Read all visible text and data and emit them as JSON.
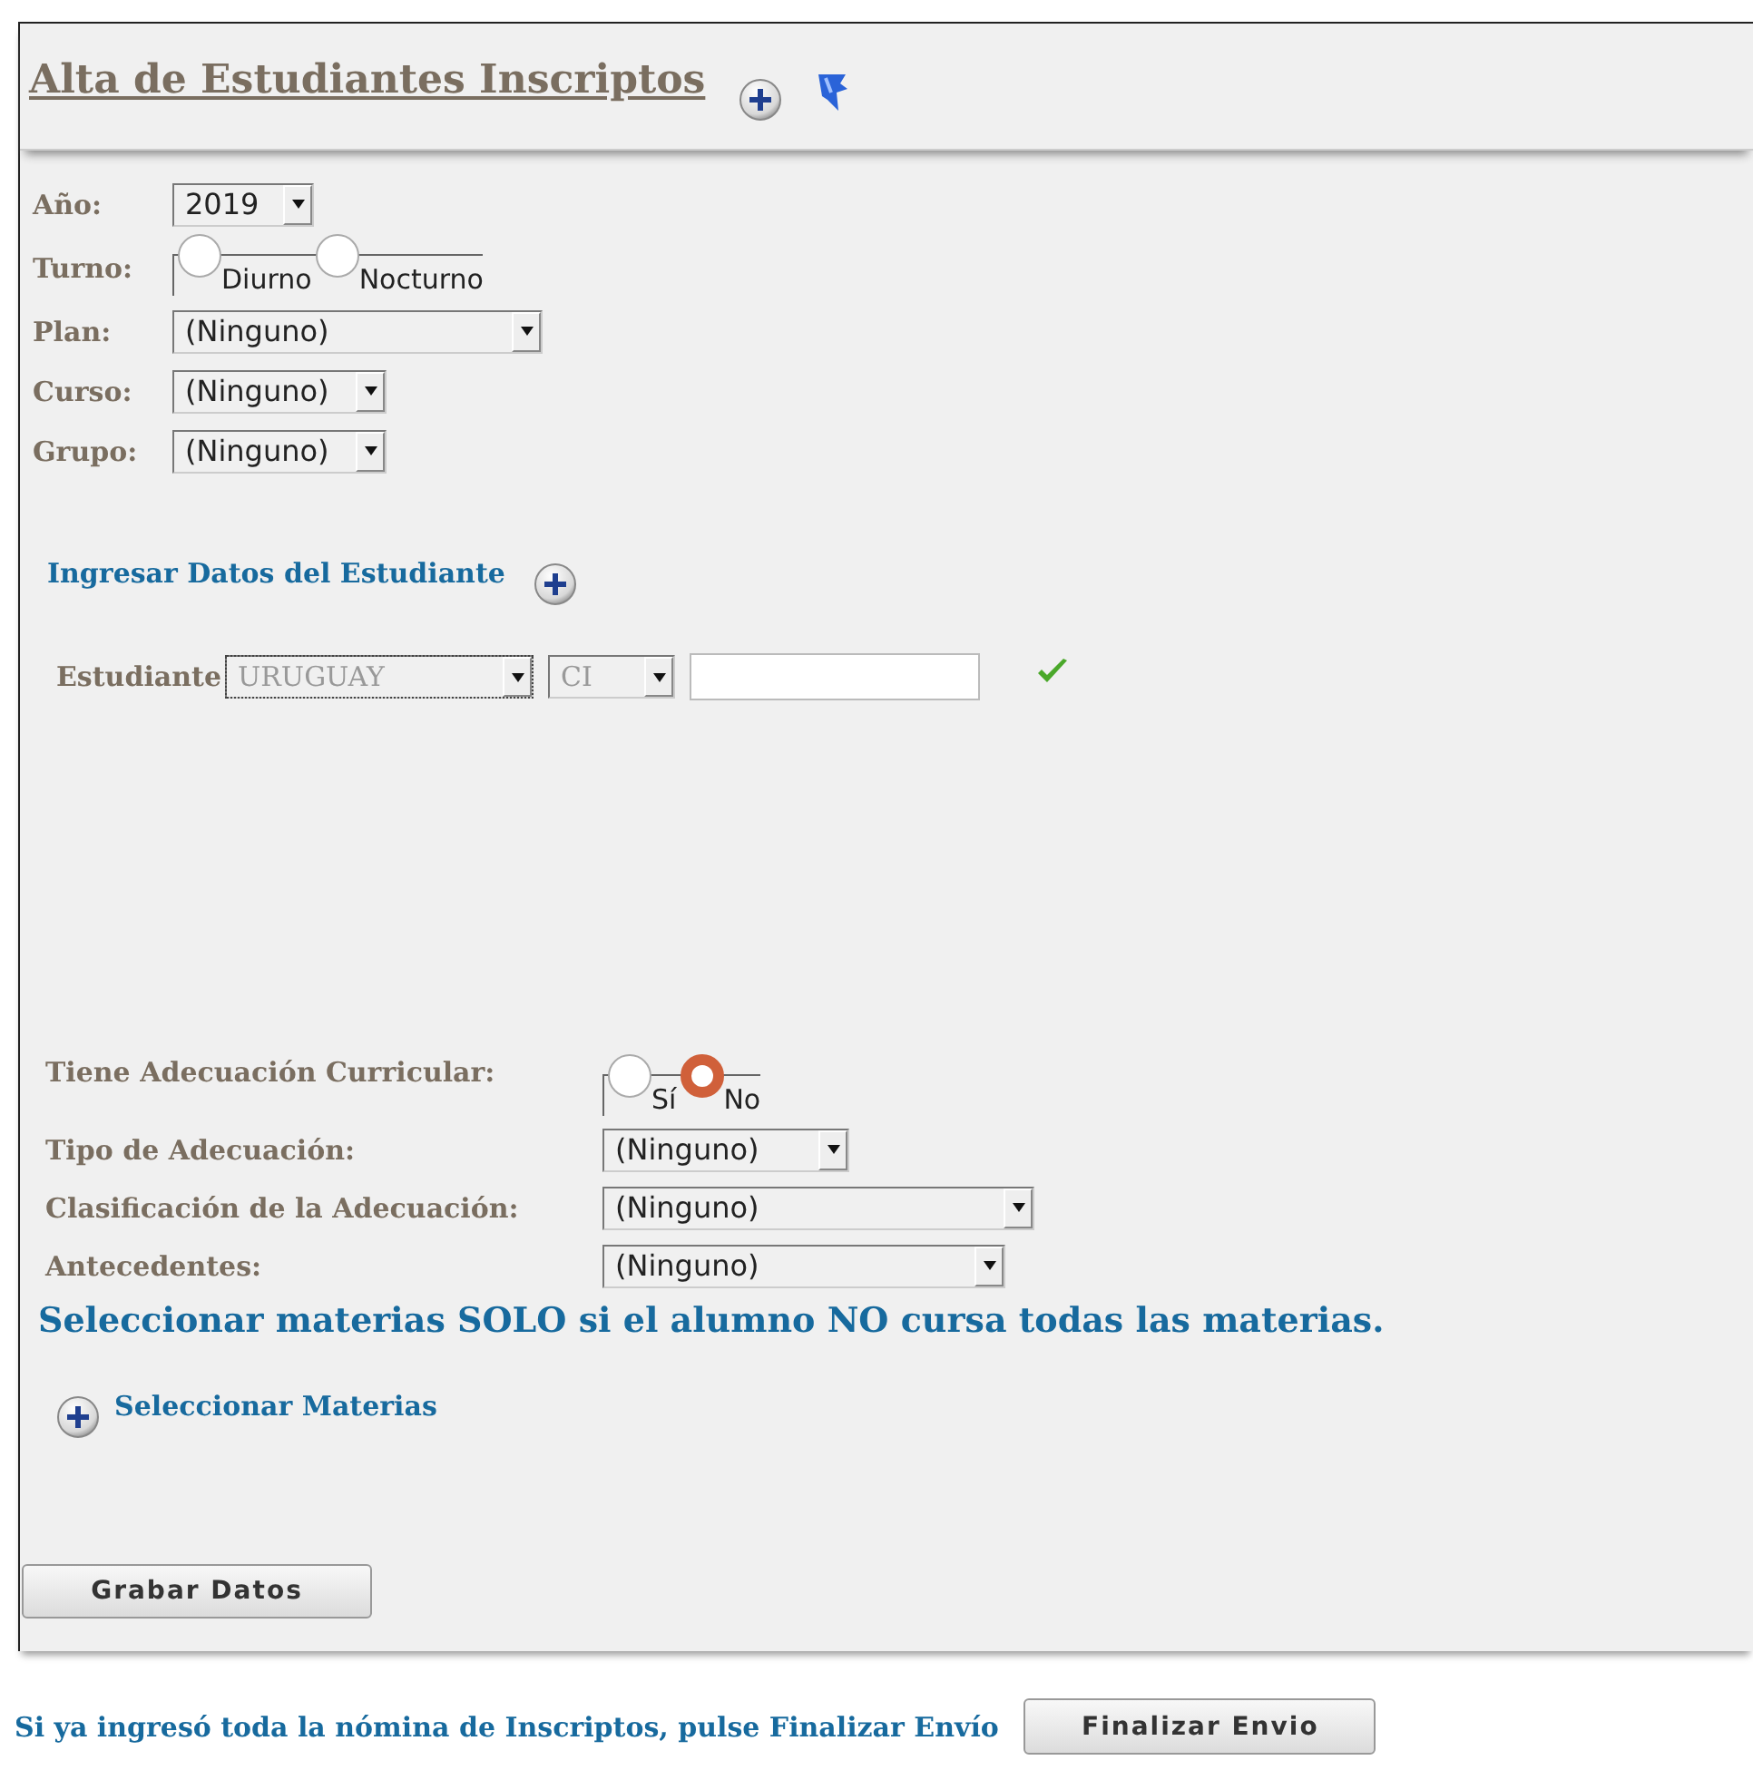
{
  "header": {
    "title": "Alta de Estudiantes Inscriptos"
  },
  "filters": [
    {
      "kind": "select",
      "label": "Año:",
      "value": "2019"
    },
    {
      "kind": "radio",
      "label": "Turno:",
      "options": [
        {
          "label": "Diurno",
          "selected": false
        },
        {
          "label": "Nocturno",
          "selected": false
        }
      ]
    },
    {
      "kind": "select",
      "label": "Plan:",
      "value": "(Ninguno)"
    },
    {
      "kind": "select",
      "label": "Curso:",
      "value": "(Ninguno)"
    },
    {
      "kind": "select",
      "label": "Grupo:",
      "value": "(Ninguno)"
    }
  ],
  "student": {
    "title": "Ingresar Datos del Estudiante",
    "label": "Estudiante",
    "country": "URUGUAY",
    "doc_type": "CI"
  },
  "adequacy": [
    {
      "kind": "radio",
      "label": "Tiene Adecuación Curricular:",
      "options": [
        {
          "label": "Sí",
          "selected": false
        },
        {
          "label": "No",
          "selected": true
        }
      ]
    },
    {
      "kind": "select",
      "label": "Tipo de Adecuación:",
      "value": "(Ninguno)"
    },
    {
      "kind": "select",
      "label": "Clasificación de la Adecuación:",
      "value": "(Ninguno)"
    },
    {
      "kind": "select",
      "label": "Antecedentes:",
      "value": "(Ninguno)"
    }
  ],
  "notice": "Seleccionar materias SOLO si el alumno NO cursa todas las materias.",
  "select_subjects": "Seleccionar Materias",
  "save_button": "Grabar Datos",
  "footer": {
    "text": "Si ya ingresó toda la nómina de Inscriptos, pulse Finalizar Envío",
    "button": "Finalizar Envio"
  }
}
